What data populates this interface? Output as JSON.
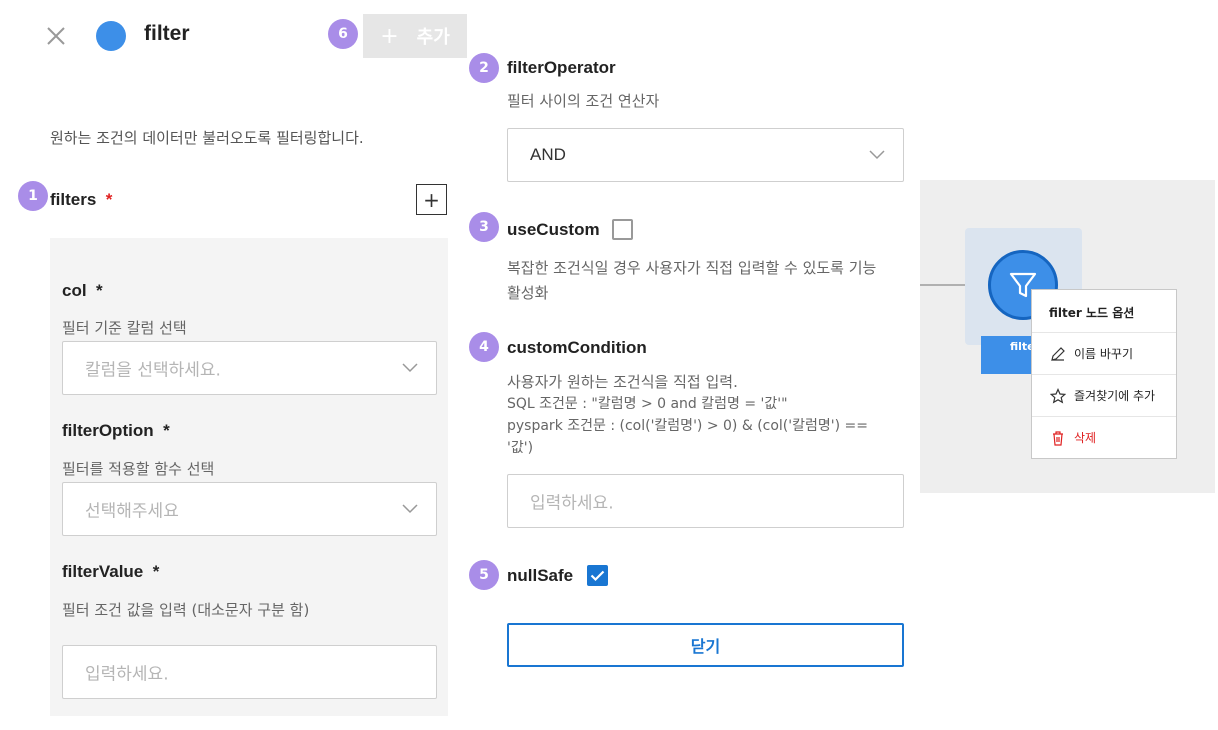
{
  "header": {
    "title": "filter",
    "add_button_label": "추가",
    "add_plus": "+",
    "badge6": "6",
    "brand_color": "#3d8fe8"
  },
  "left": {
    "description": "원하는 조건의 데이터만 불러오도록 필터링합니다.",
    "filters": {
      "badge": "1",
      "label": "filters",
      "required": "*",
      "add_icon": "+"
    },
    "col": {
      "label": "col",
      "required": "*",
      "desc": "필터 기준 칼럼 선택",
      "placeholder": "칼럼을 선택하세요."
    },
    "filterOption": {
      "label": "filterOption",
      "required": "*",
      "desc": "필터를 적용할 함수 선택",
      "placeholder": "선택해주세요"
    },
    "filterValue": {
      "label": "filterValue",
      "required": "*",
      "desc": "필터 조건 값을 입력 (대소문자 구분 함)",
      "placeholder": "입력하세요."
    }
  },
  "right": {
    "filterOperator": {
      "badge": "2",
      "label": "filterOperator",
      "desc": "필터 사이의 조건 연산자",
      "value": "AND"
    },
    "useCustom": {
      "badge": "3",
      "label": "useCustom",
      "checked": false,
      "desc_line1": "복잡한 조건식일 경우 사용자가 직접 입력할 수 있도록 기능",
      "desc_line2": "활성화"
    },
    "customCondition": {
      "badge": "4",
      "label": "customCondition",
      "desc_line1": "사용자가 원하는 조건식을 직접 입력.",
      "desc_line2": "SQL 조건문 : \"칼럼명 > 0 and 칼럼명 = '값'\"",
      "desc_line3": "pyspark 조건문 : (col('칼럼명') > 0) & (col('칼럼명') ==",
      "desc_line4": "'값')",
      "placeholder": "입력하세요."
    },
    "nullSafe": {
      "badge": "5",
      "label": "nullSafe",
      "checked": true
    },
    "close_button": "닫기"
  },
  "canvas": {
    "node_label": "filte",
    "menu_title": "filter 노드 옵션",
    "menu_rename": "이름 바꾸기",
    "menu_favorite": "즐겨찾기에 추가",
    "menu_delete": "삭제",
    "delete_color": "#e02020"
  }
}
